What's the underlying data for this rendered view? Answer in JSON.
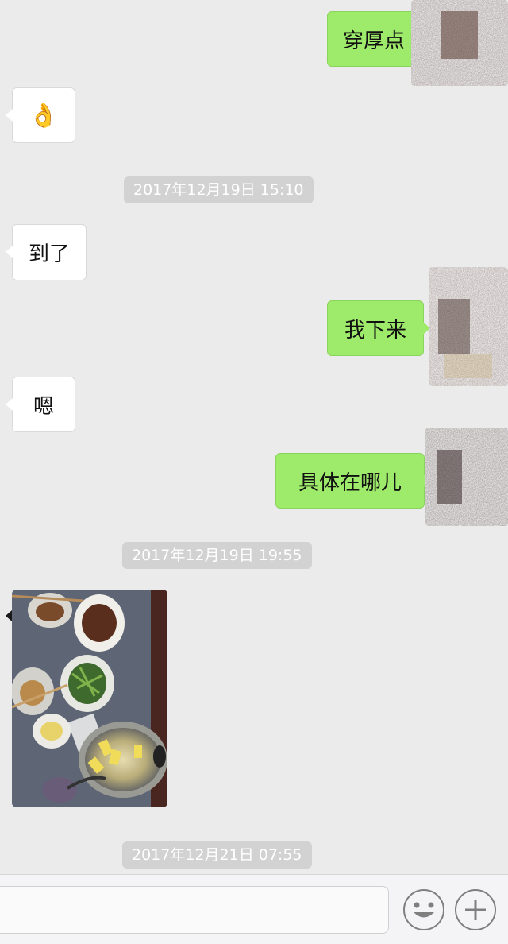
{
  "messages": [
    {
      "side": "right",
      "text": "穿厚点"
    },
    {
      "side": "left",
      "emoji": "👌"
    },
    {
      "timestamp": "2017年12月19日 15:10"
    },
    {
      "side": "left",
      "text": "到了"
    },
    {
      "side": "right",
      "text": "我下来"
    },
    {
      "side": "left",
      "text": "嗯"
    },
    {
      "side": "right",
      "text": "具体在哪儿"
    },
    {
      "timestamp": "2017年12月19日 19:55"
    },
    {
      "side": "left",
      "image": "photo-of-dinner-table"
    },
    {
      "timestamp": "2017年12月21日 07:55"
    }
  ],
  "input_bar": {
    "placeholder": "",
    "emoji_icon": "emoji-face-icon",
    "add_icon": "plus-icon"
  },
  "colors": {
    "background": "#ebebeb",
    "bubble_sent": "#9eea6a",
    "bubble_received": "#ffffff",
    "timestamp_bg": "#d2d2d2"
  }
}
